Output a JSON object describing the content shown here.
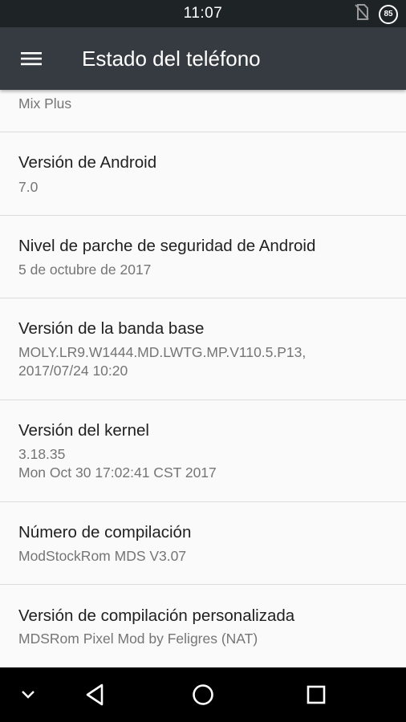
{
  "status_bar": {
    "time": "11:07",
    "battery_level": "85",
    "icons": [
      "no-sim-icon",
      "battery-saver-icon"
    ]
  },
  "app_bar": {
    "title": "Estado del teléfono",
    "menu_icon": "menu-icon"
  },
  "items": [
    {
      "title": "",
      "lines": [
        "Mix Plus"
      ]
    },
    {
      "title": "Versión de Android",
      "lines": [
        "7.0"
      ]
    },
    {
      "title": "Nivel de parche de seguridad de Android",
      "lines": [
        "5 de octubre de 2017"
      ]
    },
    {
      "title": "Versión de la banda base",
      "lines": [
        "MOLY.LR9.W1444.MD.LWTG.MP.V110.5.P13,",
        "2017/07/24 10:20"
      ]
    },
    {
      "title": "Versión del kernel",
      "lines": [
        "3.18.35",
        "Mon Oct 30 17:02:41 CST 2017"
      ]
    },
    {
      "title": "Número de compilación",
      "lines": [
        "ModStockRom MDS V3.07"
      ]
    },
    {
      "title": "Versión de compilación personalizada",
      "lines": [
        "MDSRom Pixel Mod by Feligres (NAT)"
      ]
    }
  ],
  "nav_bar": {
    "icons": [
      "chevron-down-icon",
      "back-icon",
      "home-icon",
      "recents-icon"
    ]
  },
  "colors": {
    "status_bar": "#1e2326",
    "app_bar": "#353b40",
    "background": "#fafafa",
    "title_text": "#212121",
    "secondary_text": "#757575",
    "divider": "#dcdcdc",
    "nav_bar": "#000000"
  }
}
